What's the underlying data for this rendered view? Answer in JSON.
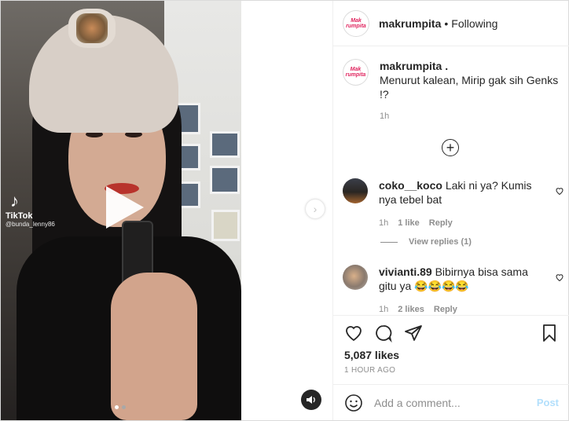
{
  "media": {
    "watermark_name": "TikTok",
    "watermark_handle": "@bunda_lenny86",
    "carousel_dots": 2,
    "active_dot": 0
  },
  "post": {
    "username": "makrumpita",
    "follow_status": "Following",
    "separator": "•",
    "avatar_text": "Mak rumpita",
    "caption_username": "makrumpita .",
    "caption_text": "Menurut kalean, Mirip gak sih Genks !?",
    "caption_time": "1h"
  },
  "comments": [
    {
      "username": "coko__koco",
      "text": "Laki ni ya? Kumis nya tebel bat",
      "time": "1h",
      "likes": "1 like",
      "reply": "Reply"
    },
    {
      "username": "vivianti.89",
      "text": "Bibirnya bisa sama gitu ya 😂😂😂😂",
      "time": "1h",
      "likes": "2 likes",
      "reply": "Reply"
    }
  ],
  "view_replies": "View replies (1)",
  "likes_count": "5,087 likes",
  "time_ago": "1 HOUR AGO",
  "add_comment": {
    "placeholder": "Add a comment...",
    "post_label": "Post"
  },
  "colors": {
    "brand_pink": "#e0245e",
    "post_disabled": "#b2dffc",
    "muted": "#8e8e8e"
  }
}
